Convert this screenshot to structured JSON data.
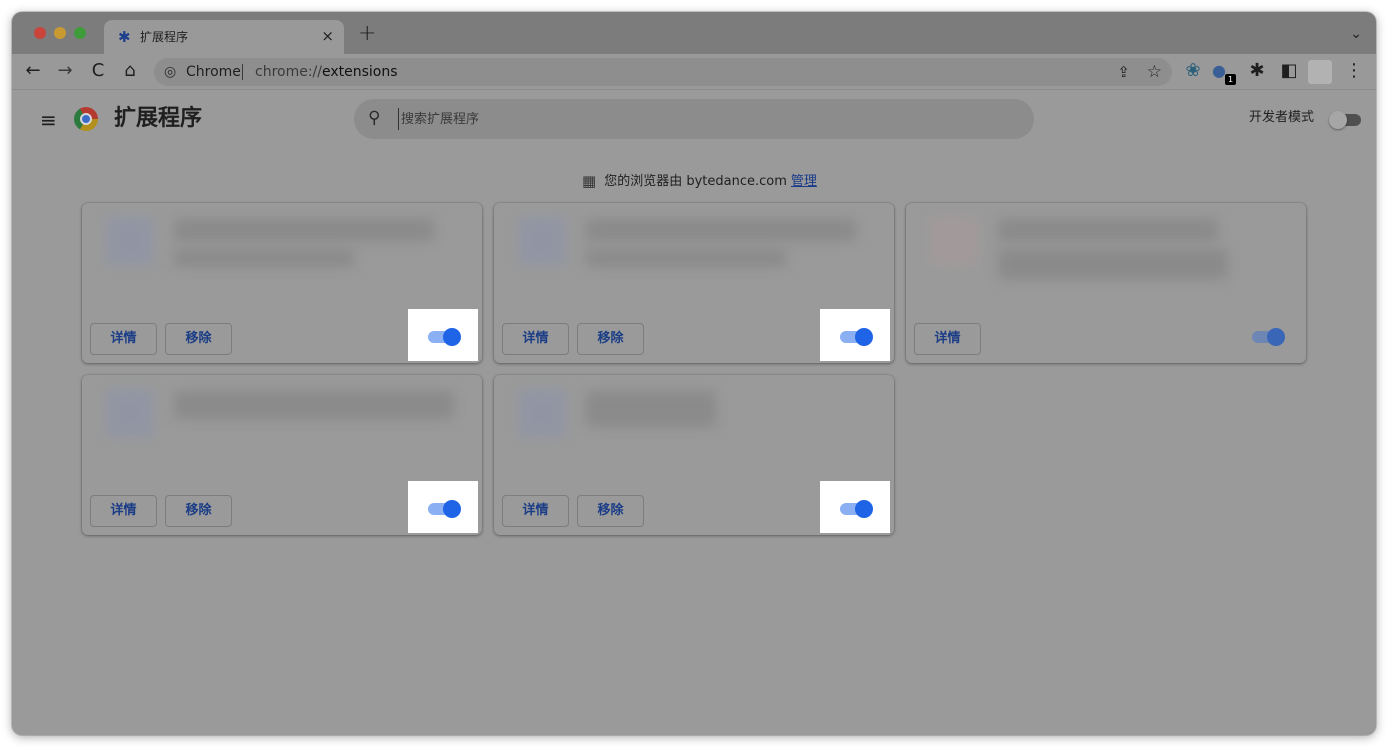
{
  "tab": {
    "title": "扩展程序",
    "close": "×",
    "new_tab": "+"
  },
  "tabstrip": {
    "menu": "⌄"
  },
  "toolbar": {
    "back": "←",
    "forward": "→",
    "reload": "C",
    "home": "⌂",
    "omnibox": {
      "chip": "Chrome",
      "url_scheme": "chrome://",
      "url_path": "extensions"
    },
    "share": "⇪",
    "bookmark": "☆",
    "extensions": [
      "❀",
      "●",
      "✱"
    ],
    "ext_badge": "1",
    "side_panel": "◧",
    "menu": "⋮"
  },
  "page": {
    "menu": "≡",
    "title": "扩展程序",
    "search": {
      "placeholder": "搜索扩展程序"
    },
    "dev_mode": {
      "label": "开发者模式",
      "enabled": false
    },
    "managed": {
      "text": "您的浏览器由 bytedance.com",
      "link": "管理"
    }
  },
  "cards": [
    {
      "details": "详情",
      "remove": "移除",
      "enabled": true
    },
    {
      "details": "详情",
      "remove": "移除",
      "enabled": true
    },
    {
      "details": "详情",
      "enabled": true
    },
    {
      "details": "详情",
      "remove": "移除",
      "enabled": true
    },
    {
      "details": "详情",
      "remove": "移除",
      "enabled": true
    }
  ]
}
